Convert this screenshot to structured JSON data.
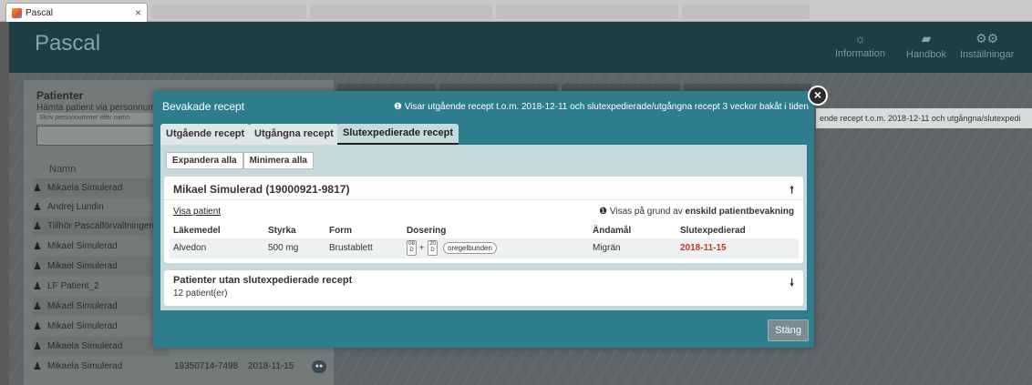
{
  "browser": {
    "tab_title": "Pascal",
    "tab_close": "×"
  },
  "header": {
    "logo": "Pascal",
    "buttons": [
      {
        "label": "Information",
        "icon": "sun-icon"
      },
      {
        "label": "Handbok",
        "icon": "book-icon"
      },
      {
        "label": "Inställningar",
        "icon": "gears-icon"
      }
    ]
  },
  "patients": {
    "title": "Patienter",
    "subtitle": "Hämta patient via personnummer",
    "input_placeholder": "Skriv personnummer eller namn",
    "column_name": "Namn",
    "rows": [
      {
        "name": "Mikaela Simulerad"
      },
      {
        "name": "Andrej Lundin"
      },
      {
        "name": "Tillhör Pascalförvaltningen"
      },
      {
        "name": "Mikael Simulerad"
      },
      {
        "name": "Mikael Simulerad"
      },
      {
        "name": "LF Patient_2"
      },
      {
        "name": "Mikael Simulerad"
      },
      {
        "name": "Mikael Simulerad"
      },
      {
        "name": "Mikaela Simulerad"
      },
      {
        "name": "Mikaela Simulerad",
        "pnr": "19350714-7498",
        "date": "2018-11-15"
      }
    ]
  },
  "background_info": "ende recept t.o.m. 2018-12-11 och utgångna/slutexpedi",
  "modal": {
    "title": "Bevakade recept",
    "notice": "Visar utgående recept t.o.m. 2018-12-11 och slutexpedierade/utgångna recept 3 veckor bakåt i tiden",
    "close_symbol": "×",
    "tabs": [
      {
        "label": "Utgående recept"
      },
      {
        "label": "Utgångna recept"
      },
      {
        "label": "Slutexpedierade recept"
      }
    ],
    "expand_all": "Expandera alla",
    "minimize_all": "Minimera alla",
    "patient_card": {
      "title": "Mikael Simulerad (19000921-9817)",
      "show_patient": "Visa patient",
      "visible_reason_prefix": "Visas på grund av ",
      "visible_reason_bold": "enskild patientbevakning",
      "columns": [
        "Läkemedel",
        "Styrka",
        "Form",
        "Dosering",
        "Ändamål",
        "Slutexpedierad"
      ],
      "row": {
        "drug": "Alvedon",
        "strength": "500 mg",
        "form": "Brustablett",
        "dose1_top": "08",
        "dose1_bottom": "D",
        "dose_plus": "+",
        "dose2_top": "20",
        "dose2_bottom": "D",
        "dose_note": "oregelbunden",
        "purpose": "Migrän",
        "dispensed": "2018-11-15"
      }
    },
    "other_card": {
      "title": "Patienter utan slutexpedierade recept",
      "subtitle": "12 patient(er)"
    },
    "close_button": "Stäng"
  },
  "colors": {
    "header_bg": "#1e3d45",
    "modal_bg": "#2e7d8c",
    "date_red": "#c0392b"
  }
}
